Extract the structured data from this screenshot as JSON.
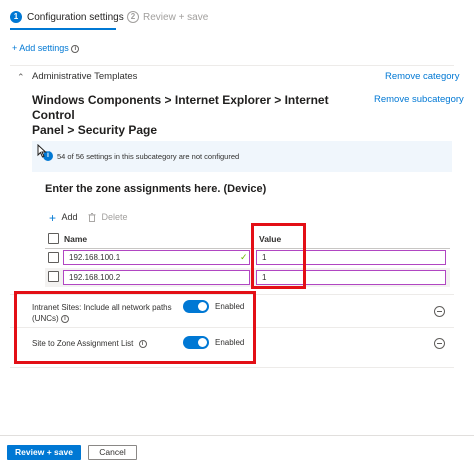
{
  "wizard": {
    "steps": [
      {
        "num": "1",
        "label": "Configuration settings"
      },
      {
        "num": "2",
        "label": "Review + save"
      }
    ]
  },
  "toolbar": {
    "add_settings": "+ Add settings"
  },
  "category": {
    "name": "Administrative Templates",
    "remove_category": "Remove category",
    "path_line1": "Windows Components > Internet Explorer > Internet Control",
    "path_line2": "Panel > Security Page",
    "remove_subcategory": "Remove subcategory"
  },
  "notice": {
    "text": "54 of 56 settings in this subcategory are not configured"
  },
  "zone": {
    "title": "Enter the zone assignments here. (Device)",
    "add_label": "Add",
    "delete_label": "Delete",
    "columns": {
      "name": "Name",
      "value": "Value"
    },
    "rows": [
      {
        "name": "192.168.100.1",
        "value": "1"
      },
      {
        "name": "192.168.100.2",
        "value": "1"
      }
    ]
  },
  "settings": [
    {
      "label_line1": "Intranet Sites: Include all network paths",
      "label_line2": "(UNCs)",
      "state": "Enabled",
      "enabled": true
    },
    {
      "label_line1": "Site to Zone Assignment List",
      "label_line2": "",
      "state": "Enabled",
      "enabled": true
    }
  ],
  "footer": {
    "review_save": "Review + save",
    "cancel": "Cancel"
  },
  "colors": {
    "accent": "#0078d4",
    "highlight_box": "#e30f16",
    "input_border": "#b146c2",
    "notice_bg": "#f0f6fc"
  }
}
